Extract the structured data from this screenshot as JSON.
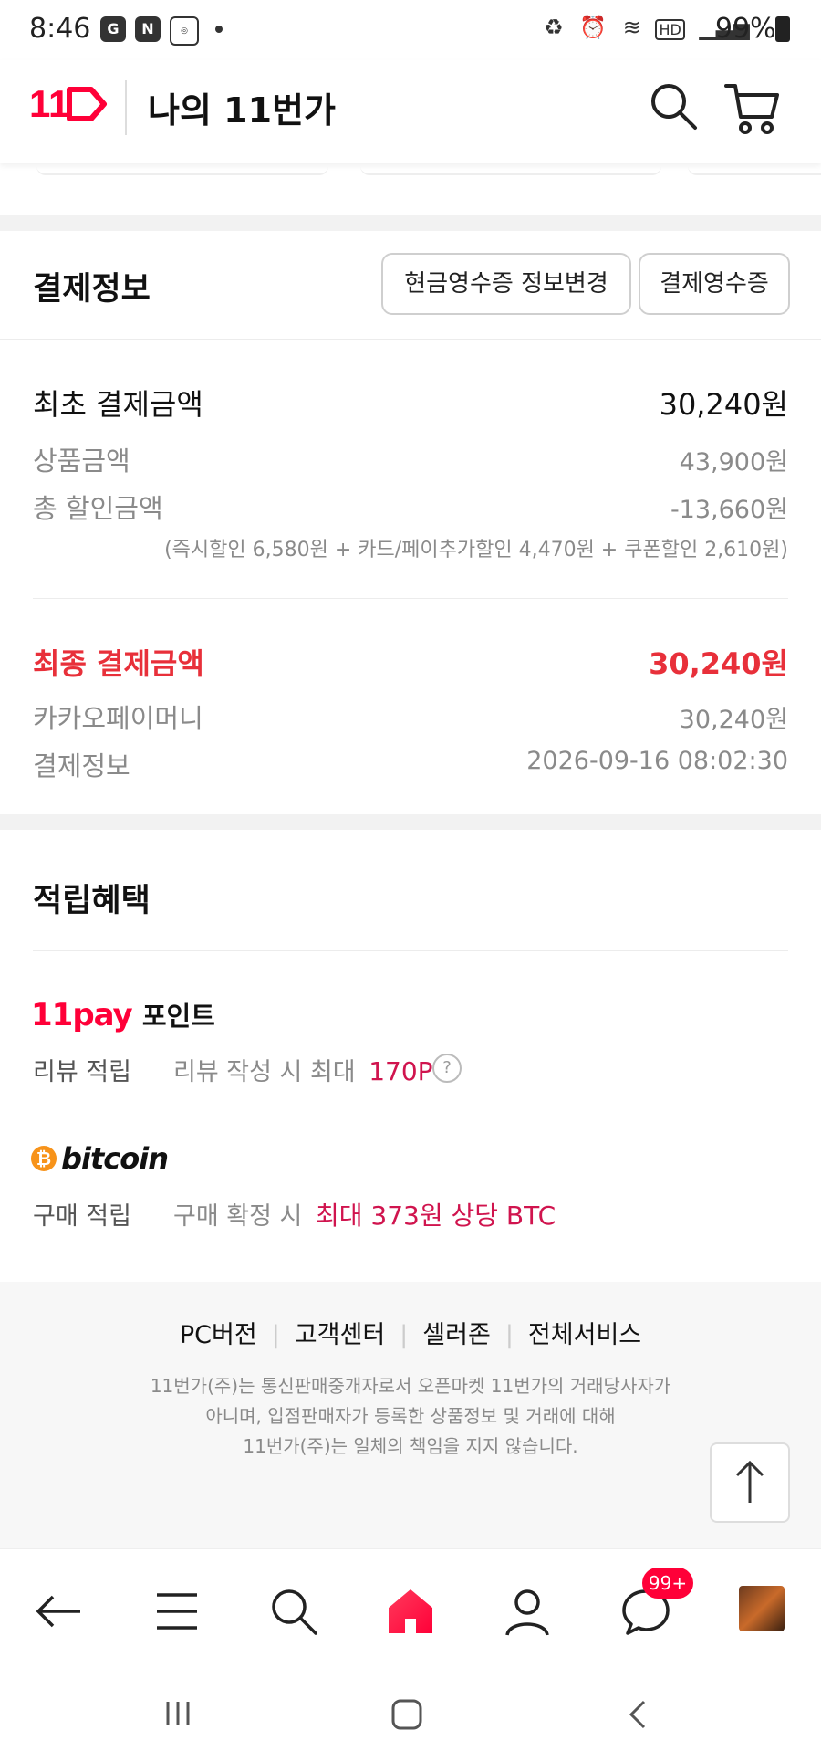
{
  "status": {
    "time": "8:46",
    "battery": "99%"
  },
  "header": {
    "logo_text": "11",
    "title": "나의 11번가"
  },
  "payment": {
    "section_title": "결제정보",
    "cash_receipt_button": "현금영수증 정보변경",
    "receipt_button": "결제영수증",
    "initial_label": "최초 결제금액",
    "initial_value": "30,240원",
    "product_label": "상품금액",
    "product_value": "43,900원",
    "discount_label": "총 할인금액",
    "discount_value": "-13,660원",
    "discount_detail": "(즉시할인 6,580원 + 카드/페이추가할인 4,470원 + 쿠폰할인 2,610원)",
    "final_label": "최종 결제금액",
    "final_value": "30,240원",
    "method_label": "카카오페이머니",
    "method_value": "30,240원",
    "info_label": "결제정보",
    "info_value": "2026-09-16 08:02:30"
  },
  "benefits": {
    "section_title": "적립혜택",
    "pay_logo": "11pay",
    "pay_points_label": "포인트",
    "review_label": "리뷰 적립",
    "review_desc": "리뷰 작성 시 최대",
    "review_value": "170P",
    "bitcoin_logo": "bitcoin",
    "purchase_label": "구매 적립",
    "purchase_desc": "구매 확정 시",
    "purchase_value": "최대 373원 상당 BTC"
  },
  "footer": {
    "links": [
      "PC버전",
      "고객센터",
      "셀러존",
      "전체서비스"
    ],
    "notice_1": "11번가(주)는 통신판매중개자로서 오픈마켓 11번가의 거래당사자가",
    "notice_2": "아니며, 입점판매자가 등록한 상품정보 및 거래에 대해",
    "notice_3": "11번가(주)는 일체의 책임을 지지 않습니다."
  },
  "bottom_nav": {
    "chat_badge": "99+"
  },
  "colors": {
    "brand_red": "#ff0038",
    "final_red": "#e8303a",
    "highlight_pink": "#d0144e"
  },
  "icons": [
    "search-icon",
    "cart-icon",
    "back-arrow-icon",
    "menu-icon",
    "home-icon",
    "profile-icon",
    "chat-icon",
    "up-arrow-icon",
    "help-icon",
    "bitcoin-icon"
  ]
}
